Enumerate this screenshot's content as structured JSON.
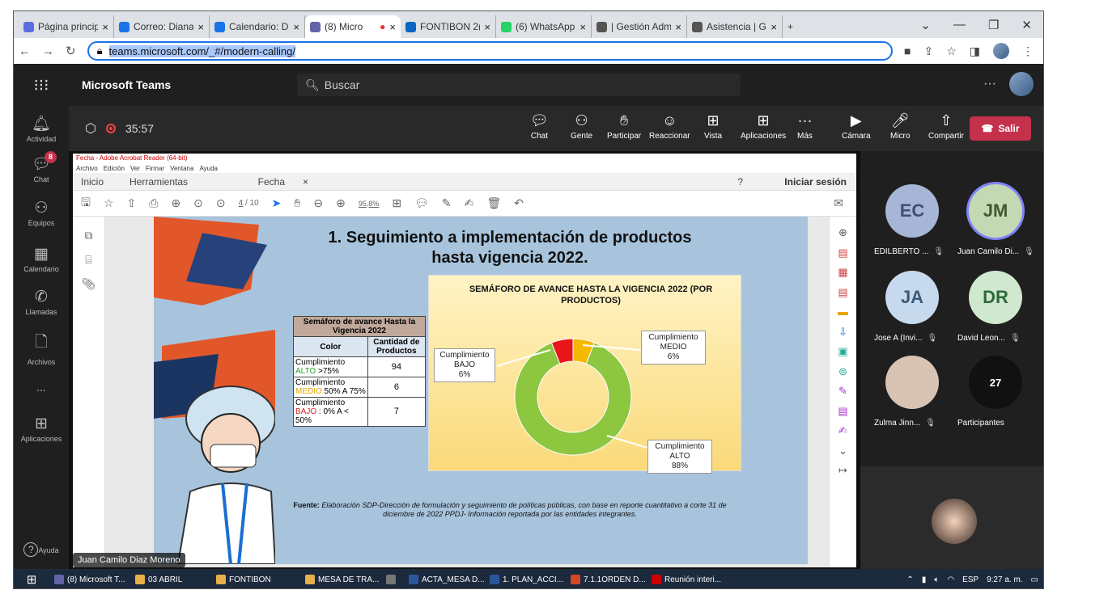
{
  "browser": {
    "tabs": [
      {
        "title": "Página princip",
        "color": "#5b6ee1"
      },
      {
        "title": "Correo: Diana",
        "color": "#1a73e8"
      },
      {
        "title": "Calendario: D",
        "color": "#1a73e8"
      },
      {
        "title": "(8) Micro",
        "color": "#6264a7",
        "active": true
      },
      {
        "title": "FONTIBON 2(",
        "color": "#0a66c2"
      },
      {
        "title": "(6) WhatsApp",
        "color": "#25d366"
      },
      {
        "title": "| Gestión Adm",
        "color": "#555"
      },
      {
        "title": "Asistencia | G",
        "color": "#555"
      }
    ],
    "new_tab": "+",
    "url": "teams.microsoft.com/_#/modern-calling/"
  },
  "teams": {
    "title": "Microsoft Teams",
    "search_placeholder": "Buscar",
    "more": "···"
  },
  "rail": [
    {
      "label": "Actividad",
      "icon": "bell-icon"
    },
    {
      "label": "Chat",
      "icon": "chat-icon",
      "badge": "8"
    },
    {
      "label": "Equipos",
      "icon": "teams-icon"
    },
    {
      "label": "Calendario",
      "icon": "calendar-icon"
    },
    {
      "label": "Llamadas",
      "icon": "phone-icon"
    },
    {
      "label": "Archivos",
      "icon": "file-icon"
    },
    {
      "label": "...",
      "icon": "more-icon"
    },
    {
      "label": "Aplicaciones",
      "icon": "apps-icon"
    },
    {
      "label": "Ayuda",
      "icon": "help-icon"
    }
  ],
  "call": {
    "timer": "35:57",
    "controls": [
      {
        "label": "Chat"
      },
      {
        "label": "Gente"
      },
      {
        "label": "Participar"
      },
      {
        "label": "Reaccionar"
      },
      {
        "label": "Vista"
      },
      {
        "label": "Aplicaciones"
      },
      {
        "label": "Más"
      },
      {
        "label": "Cámara"
      },
      {
        "label": "Micro"
      },
      {
        "label": "Compartir"
      }
    ],
    "leave": "Salir"
  },
  "acrobat": {
    "title": "Fecha - Adobe Acrobat Reader (64-bit)",
    "menu": [
      "Archivo",
      "Edición",
      "Ver",
      "Firmar",
      "Ventana",
      "Ayuda"
    ],
    "tabs": [
      "Inicio",
      "Herramientas",
      "Fecha"
    ],
    "signin": "Iniciar sesión",
    "page_num": "4",
    "page_total": "/ 10",
    "zoom": "95,8%"
  },
  "slide": {
    "title_line1": "1. Seguimiento a implementación de productos",
    "title_line2": "hasta vigencia 2022.",
    "table": {
      "header_top": "Semáforo de avance Hasta la Vigencia 2022",
      "col_color": "Color",
      "col_count": "Cantidad de Productos",
      "rows": [
        {
          "pre": "Cumplimiento ",
          "lvl": "ALTO",
          "post": " >75%",
          "value": "94",
          "lvl_color": "#2e9e2e"
        },
        {
          "pre": "Cumplimiento ",
          "lvl": "MEDIO",
          "post": " 50% A 75%",
          "value": "6",
          "lvl_color": "#e8a400"
        },
        {
          "pre": "Cumplimiento ",
          "lvl": "BAJO",
          "post": " : 0% A < 50%",
          "value": "7",
          "lvl_color": "#e02020"
        }
      ]
    },
    "fuente_label": "Fuente:",
    "fuente_text": " Elaboración SDP-Dirección de formulación y seguimiento de políticas públicas, con base en reporte cuantitativo a corte 31 de diciembre de 2022 PPDJ- Información reportada por las entidades integrantes."
  },
  "chart_data": {
    "type": "pie",
    "title": "SEMÁFORO DE AVANCE HASTA LA VIGENCIA 2022 (POR PRODUCTOS)",
    "categories": [
      "Cumplimiento ALTO",
      "Cumplimiento BAJO",
      "Cumplimiento MEDIO"
    ],
    "values": [
      88,
      6,
      6
    ],
    "colors": [
      "#8dc63f",
      "#e8151b",
      "#f5b800"
    ],
    "labels": [
      {
        "l1": "Cumplimiento",
        "l2": "ALTO",
        "l3": "88%"
      },
      {
        "l1": "Cumplimiento",
        "l2": "BAJO",
        "l3": "6%"
      },
      {
        "l1": "Cumplimiento",
        "l2": "MEDIO",
        "l3": "6%"
      }
    ]
  },
  "presenter": "Juan Camilo Diaz Moreno",
  "participants": [
    {
      "initials": "EC",
      "name": "EDILBERTO ...",
      "bg": "#a7b6d6",
      "fg": "#424f75"
    },
    {
      "initials": "JM",
      "name": "Juan Camilo Di...",
      "bg": "#c4d8b4",
      "fg": "#3e5a2e"
    },
    {
      "initials": "JA",
      "name": "Jose A (Invi...",
      "bg": "#c7d9ec",
      "fg": "#3c5a7a"
    },
    {
      "initials": "DR",
      "name": "David Leon...",
      "bg": "#cfe8cf",
      "fg": "#2d6a3a"
    },
    {
      "initials": "",
      "name": "Zulma Jinn...",
      "bg": "#d9c4b4",
      "fg": "#333"
    },
    {
      "initials": "27",
      "name": "Participantes",
      "bg": "#111",
      "fg": "#fff"
    }
  ],
  "taskbar": [
    {
      "label": "(8) Microsoft T...",
      "color": "#6264a7"
    },
    {
      "label": "03 ABRIL",
      "color": "#e8b04a"
    },
    {
      "label": "FONTIBON",
      "color": "#e8b04a"
    },
    {
      "label": "MESA DE TRA...",
      "color": "#e8b04a"
    },
    {
      "label": "",
      "color": "#777"
    },
    {
      "label": "ACTA_MESA D...",
      "color": "#2b579a"
    },
    {
      "label": "1. PLAN_ACCI...",
      "color": "#2b579a"
    },
    {
      "label": "7.1.1ORDEN D...",
      "color": "#d24726"
    },
    {
      "label": "Reunión interi...",
      "color": "#c00"
    }
  ],
  "tray": {
    "lang": "ESP",
    "time": "9:27 a. m."
  }
}
